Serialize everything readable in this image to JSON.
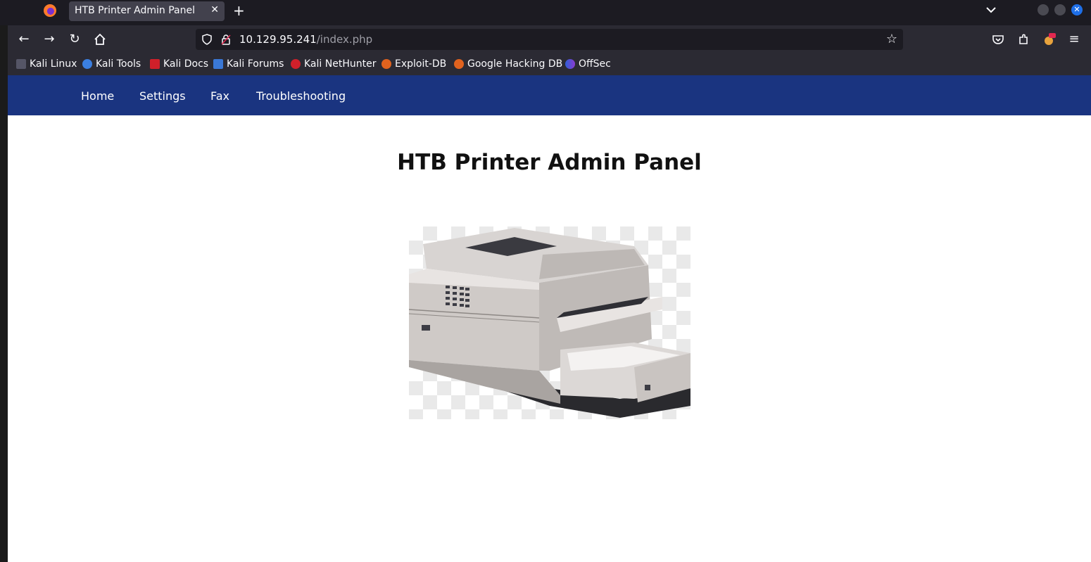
{
  "browser": {
    "tab_title": "HTB Printer Admin Panel",
    "tab_close": "✕",
    "new_tab": "+",
    "url_host": "10.129.95.241",
    "url_path": "/index.php",
    "bookmarks": [
      {
        "label": "Kali Linux",
        "icon": "kali-dragon-icon"
      },
      {
        "label": "Kali Tools",
        "icon": "kali-tools-icon"
      },
      {
        "label": "Kali Docs",
        "icon": "kali-docs-icon"
      },
      {
        "label": "Kali Forums",
        "icon": "kali-forums-icon"
      },
      {
        "label": "Kali NetHunter",
        "icon": "nethunter-icon"
      },
      {
        "label": "Exploit-DB",
        "icon": "exploit-db-icon"
      },
      {
        "label": "Google Hacking DB",
        "icon": "ghdb-icon"
      },
      {
        "label": "OffSec",
        "icon": "offsec-icon"
      }
    ]
  },
  "site": {
    "nav": [
      "Home",
      "Settings",
      "Fax",
      "Troubleshooting"
    ],
    "title": "HTB Printer Admin Panel",
    "nav_bg": "#1a3480"
  }
}
